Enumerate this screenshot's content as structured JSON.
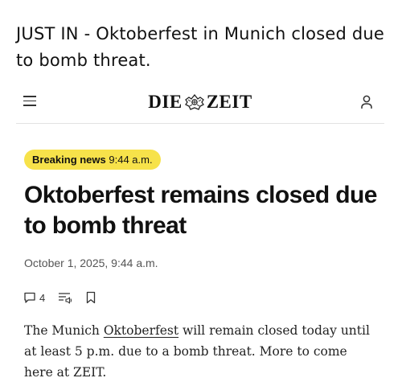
{
  "post": {
    "text": "JUST IN - Oktoberfest in Munich closed due to bomb threat."
  },
  "site": {
    "logo_left": "DIE",
    "logo_right": "ZEIT"
  },
  "article": {
    "badge_label": "Breaking news",
    "badge_time": "9:44 a.m.",
    "headline": "Oktoberfest remains closed due to bomb threat",
    "dateline": "October 1, 2025, 9:44 a.m.",
    "comment_count": "4",
    "body_before_link": "The Munich ",
    "body_link": "Oktoberfest",
    "body_after_link": " will remain closed today until at least 5 p.m. due to a bomb threat. More to come here at ZEIT."
  },
  "icons": {
    "menu": "hamburger-icon",
    "logo_crest": "eagle-crest-icon",
    "account": "user-icon",
    "comments": "speech-bubble-icon",
    "listen": "text-to-speech-icon",
    "bookmark": "bookmark-icon"
  },
  "colors": {
    "badge_background": "#f7e24a",
    "divider": "#e2e2e2"
  }
}
